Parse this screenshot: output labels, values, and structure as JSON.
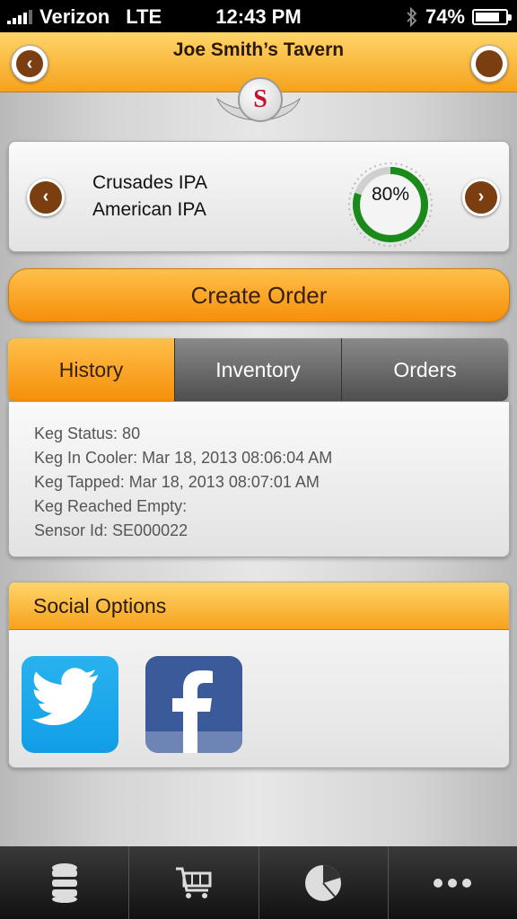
{
  "status_bar": {
    "carrier": "Verizon",
    "network": "LTE",
    "time": "12:43 PM",
    "battery_percent": "74%",
    "icons": [
      "signal-icon",
      "bluetooth-icon",
      "battery-icon"
    ]
  },
  "header": {
    "title": "Joe Smith’s Tavern",
    "logo_letter": "S",
    "colors": {
      "header_orange": "#f6a21c",
      "accent_brown": "#7a3e10"
    }
  },
  "beer_card": {
    "name_line1": "Crusades IPA",
    "name_line2": "American IPA",
    "fill_percent_label": "80%",
    "fill_fraction": 0.8,
    "gauge_color": "#1a8a1a"
  },
  "actions": {
    "create_order": "Create Order"
  },
  "tabs": [
    {
      "label": "History",
      "active": true
    },
    {
      "label": "Inventory",
      "active": false
    },
    {
      "label": "Orders",
      "active": false
    }
  ],
  "history": {
    "keg_status": "Keg Status: 80",
    "keg_in_cooler": "Keg In Cooler: Mar 18, 2013 08:06:04 AM",
    "keg_tapped": "Keg Tapped: Mar 18, 2013 08:07:01 AM",
    "keg_reached_empty": "Keg Reached Empty:",
    "sensor_id": "Sensor Id: SE000022"
  },
  "social": {
    "title": "Social Options",
    "items": [
      "twitter-icon",
      "facebook-icon"
    ]
  },
  "bottom_tabs": [
    "keg-icon",
    "cart-icon",
    "pie-chart-icon",
    "more-icon"
  ]
}
